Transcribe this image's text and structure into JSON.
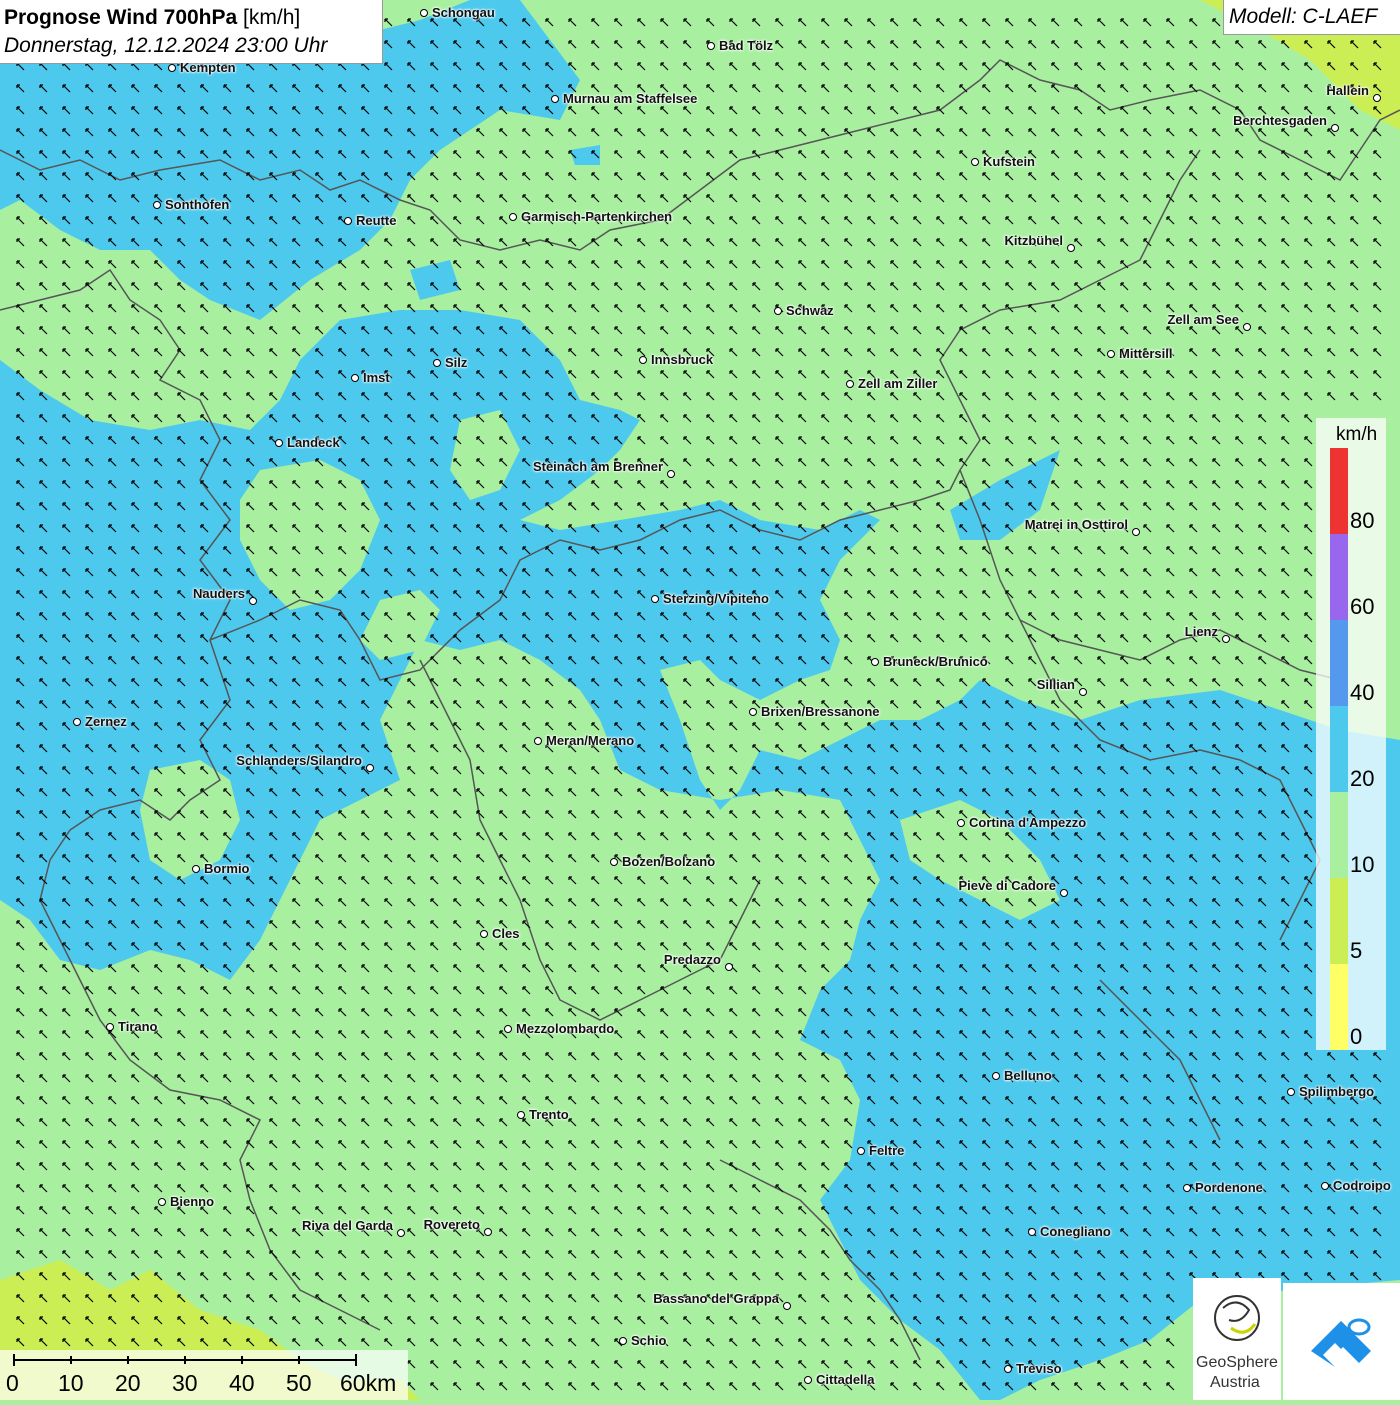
{
  "title": {
    "main": "Prognose Wind 700hPa",
    "unit": "[km/h]",
    "datetime": "Donnerstag, 12.12.2024 23:00 Uhr"
  },
  "model": "Modell: C-LAEF",
  "colors": {
    "wind_0_5": "#ffff66",
    "wind_5_10": "#ccee55",
    "wind_10_20": "#a8f0a0",
    "wind_20_40": "#4dc9ee",
    "wind_40_60": "#5599ee",
    "wind_60_80": "#9966ee",
    "wind_80_plus": "#ee3333",
    "borders": "#555555"
  },
  "legend": {
    "unit": "km/h",
    "labels": [
      "80",
      "60",
      "40",
      "20",
      "10",
      "5",
      "0"
    ]
  },
  "scale_bar": {
    "labels": [
      "0",
      "10",
      "20",
      "30",
      "40",
      "50",
      "60km"
    ]
  },
  "cities": [
    {
      "name": "Schongau"
    },
    {
      "name": "Bad Tölz"
    },
    {
      "name": "Kempten"
    },
    {
      "name": "Murnau am Staffelsee"
    },
    {
      "name": "Hallein"
    },
    {
      "name": "Berchtesgaden"
    },
    {
      "name": "Kufstein"
    },
    {
      "name": "Sonthofen"
    },
    {
      "name": "Reutte"
    },
    {
      "name": "Garmisch-Partenkirchen"
    },
    {
      "name": "Kitzbühel"
    },
    {
      "name": "Schwaz"
    },
    {
      "name": "Zell am See"
    },
    {
      "name": "Mittersill"
    },
    {
      "name": "Innsbruck"
    },
    {
      "name": "Silz"
    },
    {
      "name": "Imst"
    },
    {
      "name": "Zell am Ziller"
    },
    {
      "name": "Landeck"
    },
    {
      "name": "Steinach am Brenner"
    },
    {
      "name": "Matrei in Osttirol"
    },
    {
      "name": "Nauders"
    },
    {
      "name": "Sterzing/Vipiteno"
    },
    {
      "name": "Lienz"
    },
    {
      "name": "Bruneck/Brunico"
    },
    {
      "name": "Sillian"
    },
    {
      "name": "Brixen/Bressanone"
    },
    {
      "name": "Zernez"
    },
    {
      "name": "Meran/Merano"
    },
    {
      "name": "Schlanders/Silandro"
    },
    {
      "name": "Cortina d'Ampezzo"
    },
    {
      "name": "Bozen/Bolzano"
    },
    {
      "name": "Bormio"
    },
    {
      "name": "Pieve di Cadore"
    },
    {
      "name": "Cles"
    },
    {
      "name": "Predazzo"
    },
    {
      "name": "Tirano"
    },
    {
      "name": "Mezzolombardo"
    },
    {
      "name": "Belluno"
    },
    {
      "name": "Spilimbergo"
    },
    {
      "name": "Trento"
    },
    {
      "name": "Feltre"
    },
    {
      "name": "Pordenone"
    },
    {
      "name": "Codroipo"
    },
    {
      "name": "Bienno"
    },
    {
      "name": "Riva del Garda"
    },
    {
      "name": "Rovereto"
    },
    {
      "name": "Conegliano"
    },
    {
      "name": "Bassano del Grappa"
    },
    {
      "name": "Schio"
    },
    {
      "name": "Treviso"
    },
    {
      "name": "Cittadella"
    }
  ],
  "logo": {
    "name_line1": "GeoSphere",
    "name_line2": "Austria"
  }
}
